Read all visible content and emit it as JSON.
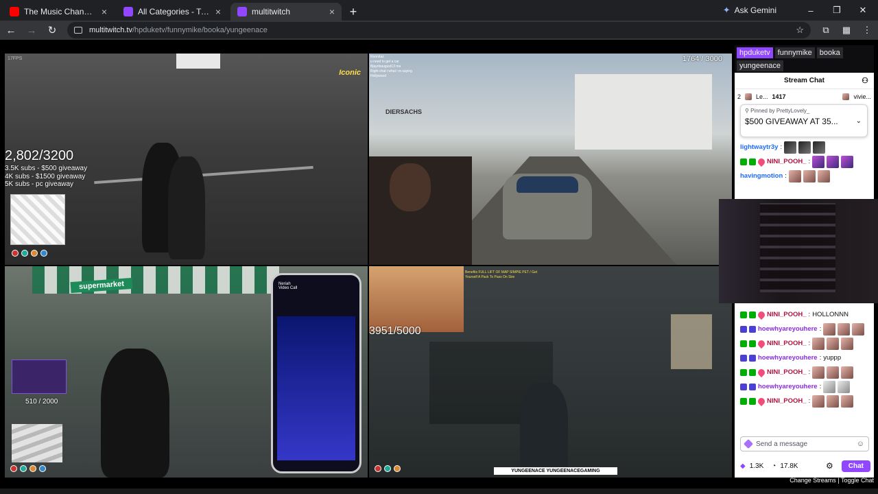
{
  "browser": {
    "tabs": [
      {
        "title": "The Music Channel - YouTube",
        "favicon_color": "#ff0000",
        "active": false
      },
      {
        "title": "All Categories - Twitch",
        "favicon_color": "#9147ff",
        "active": false
      },
      {
        "title": "multitwitch",
        "favicon_color": "#9147ff",
        "active": true
      }
    ],
    "new_tab": "+",
    "ask_gemini": "Ask Gemini",
    "url_domain": "multitwitch.tv",
    "url_path": "/hpduketv/funnymike/booka/yungeenace"
  },
  "streams": {
    "s1": {
      "counter": "2,802/3200",
      "goals": [
        "3.5K subs - $500 giveaway",
        "4K subs - $1500 giveaway",
        "5K subs - pc giveaway"
      ],
      "fps": "17FPS",
      "badge": "Iconic"
    },
    "s2": {
      "counter": "1764 / 3000",
      "sign": "DIERSACHS",
      "chat_lines": [
        "Ronnitaz",
        "u need to get a car",
        "Bjaynbaugust13 ma",
        "Right chat i what i m saying",
        "Hollywood"
      ]
    },
    "s3": {
      "store": "supermarket",
      "counter": "510 / 2000",
      "call_name": "Neriah",
      "call_sub": "Video Call"
    },
    "s4": {
      "counter": "3951/5000",
      "tag": "YUNGEENACE YUNGEENACEGAMING",
      "notes": "Benefits FULL LIFT OF MAP SIMPIE PET / Get Yourself A Pack To Pass On Stre"
    }
  },
  "chat": {
    "stream_tabs": [
      "hpduketv",
      "funnymike",
      "booka",
      "yungeenace"
    ],
    "title": "Stream Chat",
    "leaderboard": [
      {
        "rank": "2",
        "name": "Le...",
        "amount": "1417"
      },
      {
        "rank": "",
        "name": "vivie...",
        "amount": ""
      }
    ],
    "pinned_by": "Pinned by PrettyLovely_",
    "pinned_message": "$500 GIVEAWAY AT 35...",
    "messages_top": [
      {
        "user": "lightwaytr3y",
        "color": "#1e69ff",
        "text": "",
        "emotes": [
          "d",
          "d",
          "d"
        ],
        "badges": []
      },
      {
        "user": "NINI_POOH_",
        "color": "#b11240",
        "text": "",
        "emotes": [
          "b",
          "b",
          "b"
        ],
        "badges": [
          "g",
          "g",
          "h"
        ]
      },
      {
        "user": "havingmotion",
        "color": "#1e69ff",
        "text": "",
        "emotes": [
          "a",
          "a",
          "a"
        ],
        "badges": []
      }
    ],
    "messages_bottom": [
      {
        "user": "NINI_POOH_",
        "color": "#b11240",
        "text": "HOLLONNN",
        "emotes": [],
        "badges": [
          "g",
          "g",
          "h"
        ]
      },
      {
        "user": "hoewhyareyouhere",
        "color": "#8a2be2",
        "text": "",
        "emotes": [
          "a",
          "a",
          "a"
        ],
        "badges": [
          "p",
          "p"
        ]
      },
      {
        "user": "NINI_POOH_",
        "color": "#b11240",
        "text": "",
        "emotes": [
          "a",
          "a",
          "a"
        ],
        "badges": [
          "g",
          "g",
          "h"
        ]
      },
      {
        "user": "hoewhyareyouhere",
        "color": "#8a2be2",
        "text": "yuppp",
        "emotes": [],
        "badges": [
          "p",
          "p"
        ]
      },
      {
        "user": "NINI_POOH_",
        "color": "#b11240",
        "text": "",
        "emotes": [
          "a",
          "a",
          "a"
        ],
        "badges": [
          "g",
          "g",
          "h"
        ]
      },
      {
        "user": "hoewhyareyouhere",
        "color": "#8a2be2",
        "text": "",
        "emotes": [
          "c",
          "c"
        ],
        "badges": [
          "p",
          "p"
        ]
      },
      {
        "user": "NINI_POOH_",
        "color": "#b11240",
        "text": "",
        "emotes": [
          "a",
          "a",
          "a"
        ],
        "badges": [
          "g",
          "g",
          "h"
        ]
      }
    ],
    "input_placeholder": "Send a message",
    "points": "1.3K",
    "viewers": "17.8K",
    "chat_button": "Chat",
    "links": "Change Streams | Toggle Chat"
  }
}
